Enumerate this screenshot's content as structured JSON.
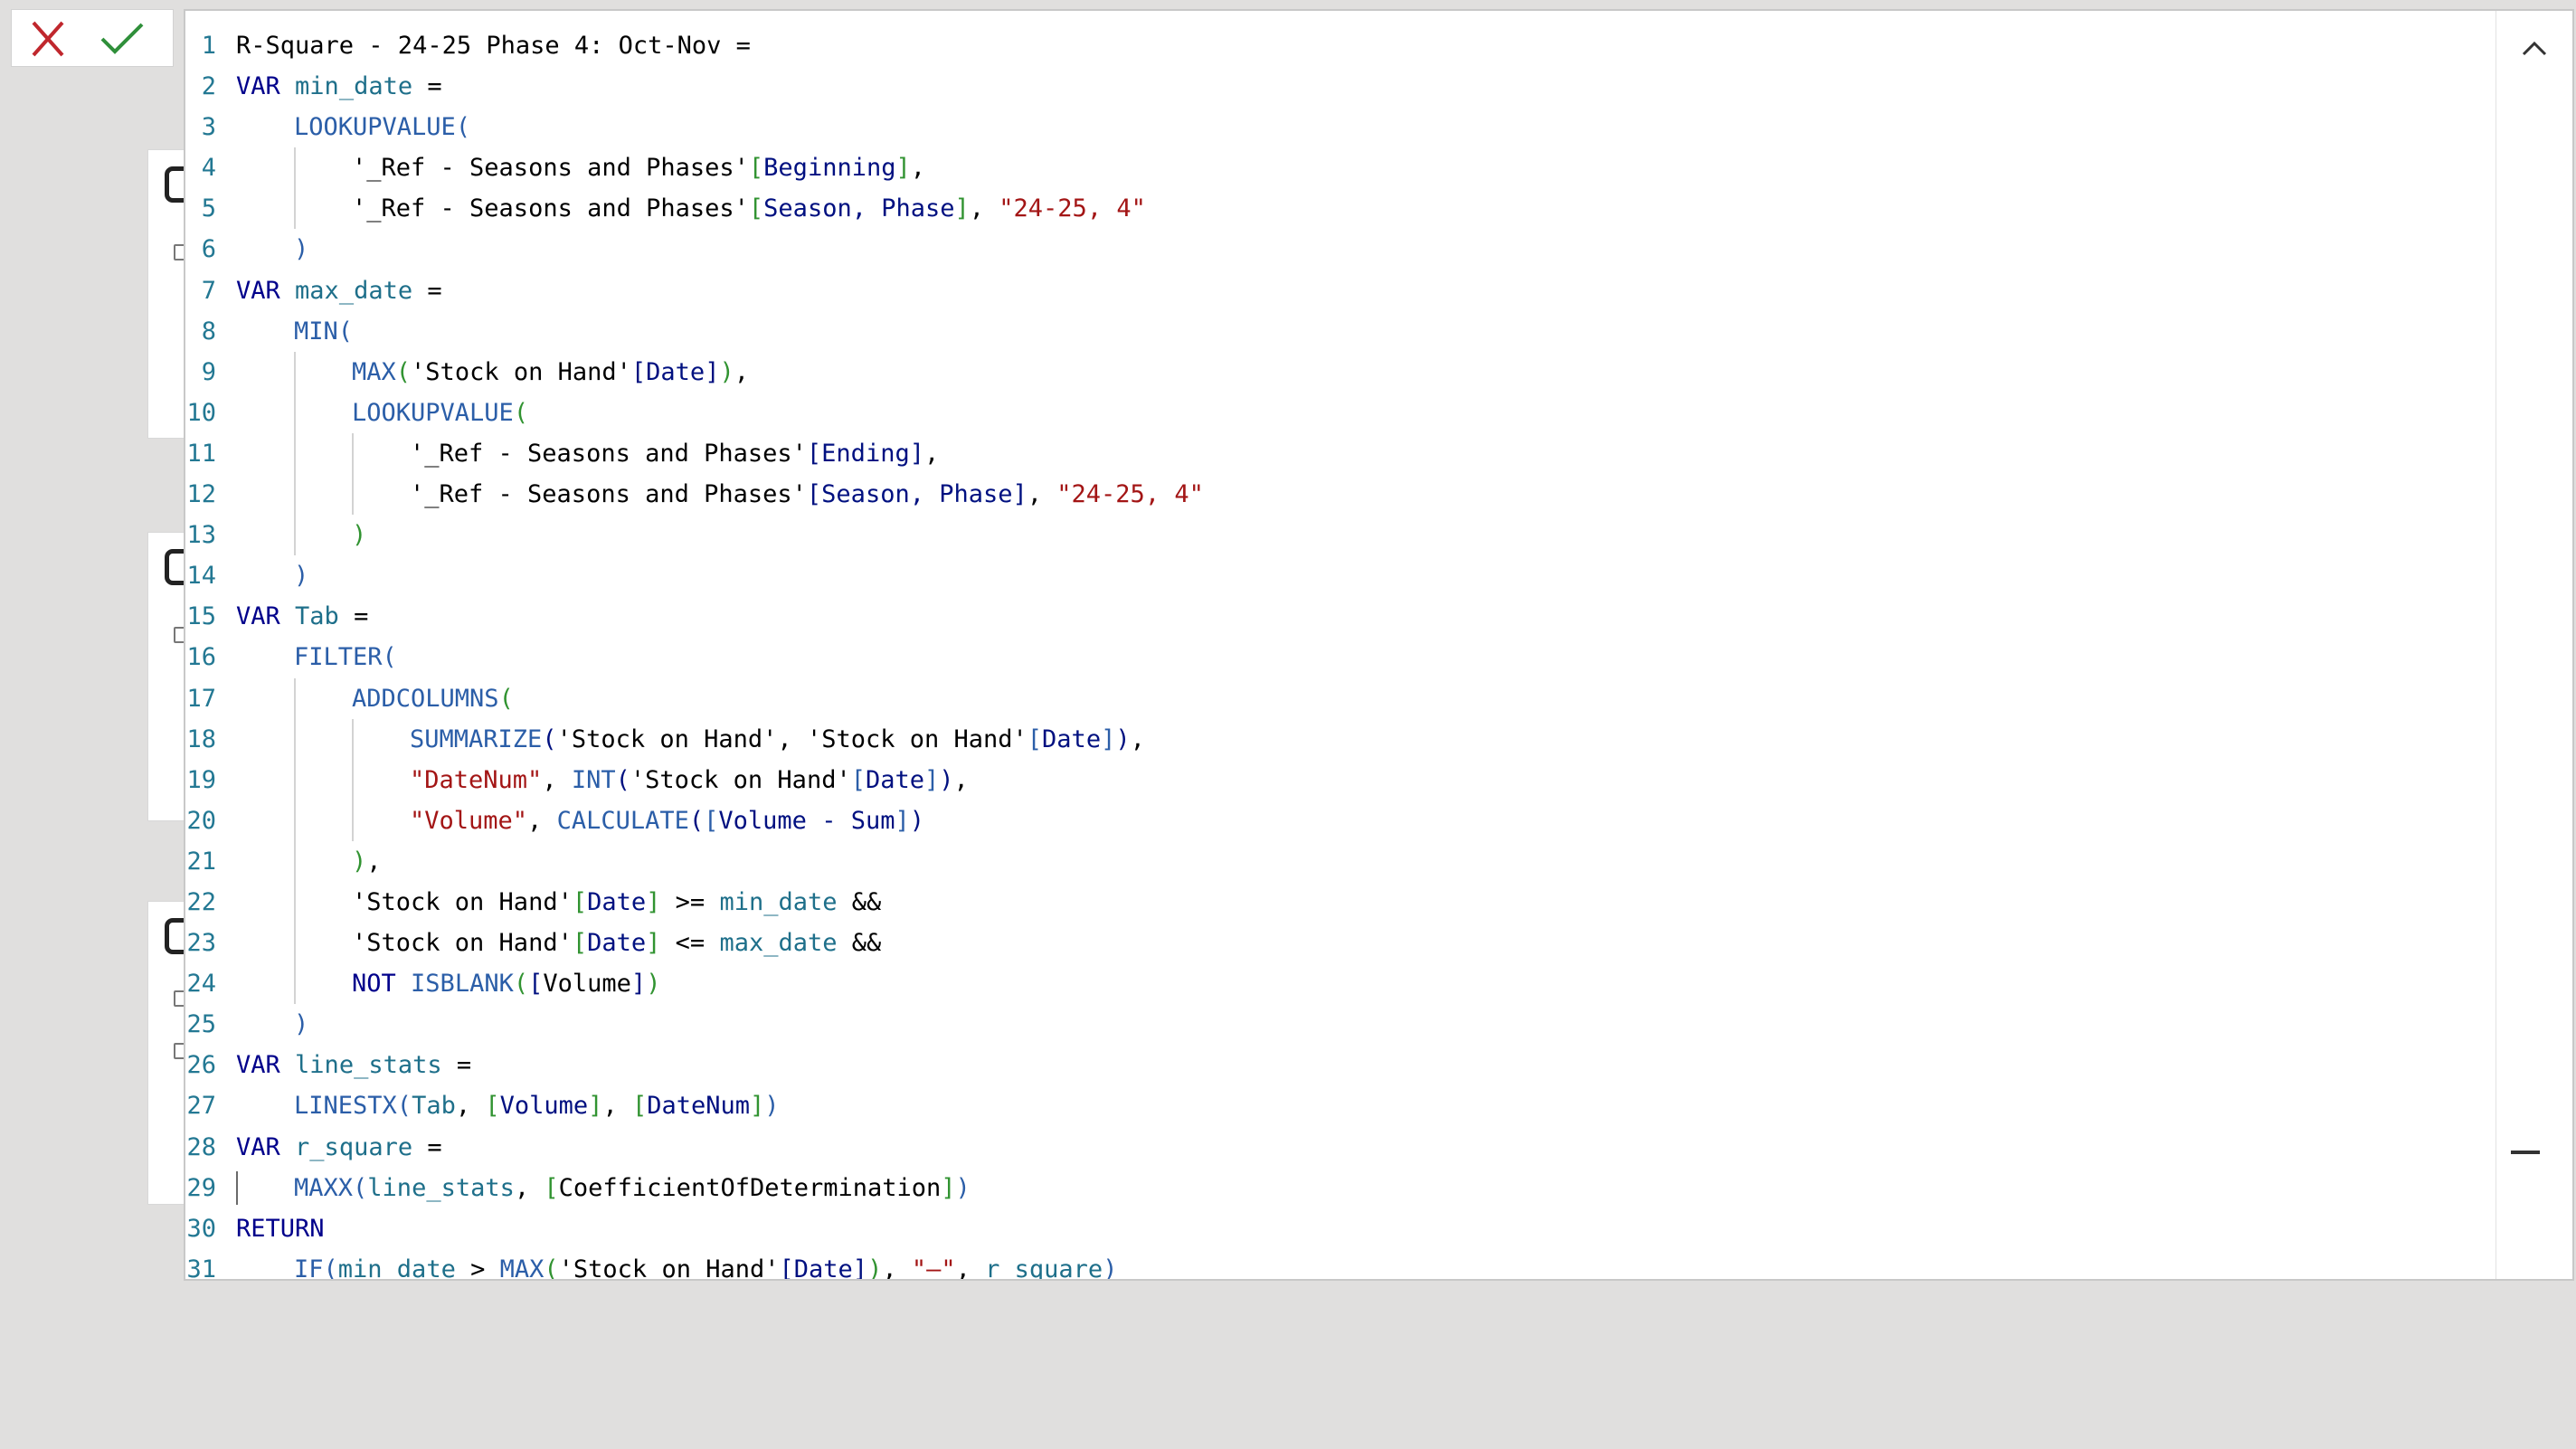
{
  "toolbar": {
    "cancel_icon": "close-icon",
    "commit_icon": "checkmark-icon",
    "cancel_color": "#c0272d",
    "commit_color": "#2f8f3a"
  },
  "editor": {
    "collapse_icon": "chevron-up-icon",
    "lines": [
      {
        "n": "1",
        "tokens": [
          [
            "R-Square - 24-25 Phase 4: Oct-Nov =",
            ""
          ]
        ]
      },
      {
        "n": "2",
        "tokens": [
          [
            "VAR",
            "t-kw"
          ],
          [
            " ",
            ""
          ],
          [
            "min_date",
            "t-var"
          ],
          [
            " =",
            ""
          ]
        ]
      },
      {
        "n": "3",
        "indent": 1,
        "tokens": [
          [
            "LOOKUPVALUE",
            "t-fn"
          ],
          [
            "(",
            "t-fn"
          ]
        ]
      },
      {
        "n": "4",
        "indent": 2,
        "tokens": [
          [
            "'_Ref - Seasons and Phases'",
            ""
          ],
          [
            "[",
            "t-br"
          ],
          [
            "Beginning",
            "t-col"
          ],
          [
            "]",
            "t-br"
          ],
          [
            ",",
            ""
          ]
        ]
      },
      {
        "n": "5",
        "indent": 2,
        "tokens": [
          [
            "'_Ref - Seasons and Phases'",
            ""
          ],
          [
            "[",
            "t-br"
          ],
          [
            "Season, Phase",
            "t-col"
          ],
          [
            "]",
            "t-br"
          ],
          [
            ", ",
            ""
          ],
          [
            "\"24-25, 4\"",
            "t-str"
          ]
        ]
      },
      {
        "n": "6",
        "indent": 1,
        "tokens": [
          [
            ")",
            "t-fn"
          ]
        ]
      },
      {
        "n": "7",
        "tokens": [
          [
            "VAR",
            "t-kw"
          ],
          [
            " ",
            ""
          ],
          [
            "max_date",
            "t-var"
          ],
          [
            " =",
            ""
          ]
        ]
      },
      {
        "n": "8",
        "indent": 1,
        "tokens": [
          [
            "MIN",
            "t-fn"
          ],
          [
            "(",
            "t-fn"
          ]
        ]
      },
      {
        "n": "9",
        "indent": 2,
        "tokens": [
          [
            "MAX",
            "t-fn"
          ],
          [
            "(",
            "t-br"
          ],
          [
            "'Stock on Hand'",
            ""
          ],
          [
            "[",
            "t-col"
          ],
          [
            "Date",
            "t-col"
          ],
          [
            "]",
            "t-col"
          ],
          [
            ")",
            "t-br"
          ],
          [
            ",",
            ""
          ]
        ]
      },
      {
        "n": "10",
        "indent": 2,
        "tokens": [
          [
            "LOOKUPVALUE",
            "t-fn"
          ],
          [
            "(",
            "t-br"
          ]
        ]
      },
      {
        "n": "11",
        "indent": 3,
        "tokens": [
          [
            "'_Ref - Seasons and Phases'",
            ""
          ],
          [
            "[",
            "t-col"
          ],
          [
            "Ending",
            "t-col"
          ],
          [
            "]",
            "t-col"
          ],
          [
            ",",
            ""
          ]
        ]
      },
      {
        "n": "12",
        "indent": 3,
        "tokens": [
          [
            "'_Ref - Seasons and Phases'",
            ""
          ],
          [
            "[",
            "t-col"
          ],
          [
            "Season, Phase",
            "t-col"
          ],
          [
            "]",
            "t-col"
          ],
          [
            ", ",
            ""
          ],
          [
            "\"24-25, 4\"",
            "t-str"
          ]
        ]
      },
      {
        "n": "13",
        "indent": 2,
        "tokens": [
          [
            ")",
            "t-br"
          ]
        ]
      },
      {
        "n": "14",
        "indent": 1,
        "tokens": [
          [
            ")",
            "t-fn"
          ]
        ]
      },
      {
        "n": "15",
        "tokens": [
          [
            "VAR",
            "t-kw"
          ],
          [
            " ",
            ""
          ],
          [
            "Tab",
            "t-var"
          ],
          [
            " =",
            ""
          ]
        ]
      },
      {
        "n": "16",
        "indent": 1,
        "tokens": [
          [
            "FILTER",
            "t-fn"
          ],
          [
            "(",
            "t-fn"
          ]
        ]
      },
      {
        "n": "17",
        "indent": 2,
        "tokens": [
          [
            "ADDCOLUMNS",
            "t-fn"
          ],
          [
            "(",
            "t-br"
          ]
        ]
      },
      {
        "n": "18",
        "indent": 3,
        "tokens": [
          [
            "SUMMARIZE",
            "t-fn"
          ],
          [
            "(",
            "t-col"
          ],
          [
            "'Stock on Hand'",
            ""
          ],
          [
            ", ",
            ""
          ],
          [
            "'Stock on Hand'",
            ""
          ],
          [
            "[",
            "t-fn"
          ],
          [
            "Date",
            "t-col"
          ],
          [
            "]",
            "t-fn"
          ],
          [
            ")",
            "t-col"
          ],
          [
            ",",
            ""
          ]
        ]
      },
      {
        "n": "19",
        "indent": 3,
        "tokens": [
          [
            "\"DateNum\"",
            "t-str"
          ],
          [
            ", ",
            ""
          ],
          [
            "INT",
            "t-fn"
          ],
          [
            "(",
            "t-col"
          ],
          [
            "'Stock on Hand'",
            ""
          ],
          [
            "[",
            "t-fn"
          ],
          [
            "Date",
            "t-col"
          ],
          [
            "]",
            "t-fn"
          ],
          [
            ")",
            "t-col"
          ],
          [
            ",",
            ""
          ]
        ]
      },
      {
        "n": "20",
        "indent": 3,
        "tokens": [
          [
            "\"Volume\"",
            "t-str"
          ],
          [
            ", ",
            ""
          ],
          [
            "CALCULATE",
            "t-fn"
          ],
          [
            "(",
            "t-col"
          ],
          [
            "[",
            "t-fn"
          ],
          [
            "Volume - Sum",
            "t-col"
          ],
          [
            "]",
            "t-fn"
          ],
          [
            ")",
            "t-col"
          ]
        ]
      },
      {
        "n": "21",
        "indent": 2,
        "tokens": [
          [
            ")",
            "t-br"
          ],
          [
            ",",
            ""
          ]
        ]
      },
      {
        "n": "22",
        "indent": 2,
        "tokens": [
          [
            "'Stock on Hand'",
            ""
          ],
          [
            "[",
            "t-br"
          ],
          [
            "Date",
            "t-col"
          ],
          [
            "]",
            "t-br"
          ],
          [
            " >= ",
            ""
          ],
          [
            "min_date",
            "t-var"
          ],
          [
            " &&",
            ""
          ]
        ]
      },
      {
        "n": "23",
        "indent": 2,
        "tokens": [
          [
            "'Stock on Hand'",
            ""
          ],
          [
            "[",
            "t-br"
          ],
          [
            "Date",
            "t-col"
          ],
          [
            "]",
            "t-br"
          ],
          [
            " <= ",
            ""
          ],
          [
            "max_date",
            "t-var"
          ],
          [
            " &&",
            ""
          ]
        ]
      },
      {
        "n": "24",
        "indent": 2,
        "tokens": [
          [
            "NOT",
            "t-kw"
          ],
          [
            " ",
            ""
          ],
          [
            "ISBLANK",
            "t-fn"
          ],
          [
            "(",
            "t-br"
          ],
          [
            "[",
            "t-col"
          ],
          [
            "Volume",
            ""
          ],
          [
            "]",
            "t-col"
          ],
          [
            ")",
            "t-br"
          ]
        ]
      },
      {
        "n": "25",
        "indent": 1,
        "tokens": [
          [
            ")",
            "t-fn"
          ]
        ]
      },
      {
        "n": "26",
        "tokens": [
          [
            "VAR",
            "t-kw"
          ],
          [
            " ",
            ""
          ],
          [
            "line_stats",
            "t-var"
          ],
          [
            " =",
            ""
          ]
        ]
      },
      {
        "n": "27",
        "indent": 1,
        "tokens": [
          [
            "LINESTX",
            "t-fn"
          ],
          [
            "(",
            "t-fn"
          ],
          [
            "Tab",
            "t-var"
          ],
          [
            ", ",
            ""
          ],
          [
            "[",
            "t-br"
          ],
          [
            "Volume",
            "t-col"
          ],
          [
            "]",
            "t-br"
          ],
          [
            ", ",
            ""
          ],
          [
            "[",
            "t-br"
          ],
          [
            "DateNum",
            "t-col"
          ],
          [
            "]",
            "t-br"
          ],
          [
            ")",
            "t-fn"
          ]
        ]
      },
      {
        "n": "28",
        "tokens": [
          [
            "VAR",
            "t-kw"
          ],
          [
            " ",
            ""
          ],
          [
            "r_square",
            "t-var"
          ],
          [
            " =",
            ""
          ]
        ]
      },
      {
        "n": "29",
        "indent": 1,
        "cursor": true,
        "tokens": [
          [
            "MAXX",
            "t-fn"
          ],
          [
            "(",
            "t-fn"
          ],
          [
            "line_stats",
            "t-var"
          ],
          [
            ", ",
            ""
          ],
          [
            "[",
            "t-br"
          ],
          [
            "CoefficientOfDetermination",
            ""
          ],
          [
            "]",
            "t-br"
          ],
          [
            ")",
            "t-fn"
          ]
        ]
      },
      {
        "n": "30",
        "tokens": [
          [
            "RETURN",
            "t-kw"
          ]
        ]
      },
      {
        "n": "31",
        "indent": 1,
        "tokens": [
          [
            "IF",
            "t-fn"
          ],
          [
            "(",
            "t-fn"
          ],
          [
            "min_date",
            "t-var"
          ],
          [
            " > ",
            ""
          ],
          [
            "MAX",
            "t-fn"
          ],
          [
            "(",
            "t-br"
          ],
          [
            "'Stock on Hand'",
            ""
          ],
          [
            "[",
            "t-col"
          ],
          [
            "Date",
            "t-col"
          ],
          [
            "]",
            "t-col"
          ],
          [
            ")",
            "t-br"
          ],
          [
            ", ",
            ""
          ],
          [
            "\"–\"",
            "t-str"
          ],
          [
            ", ",
            ""
          ],
          [
            "r_square",
            "t-var"
          ],
          [
            ")",
            "t-fn"
          ]
        ]
      }
    ]
  }
}
